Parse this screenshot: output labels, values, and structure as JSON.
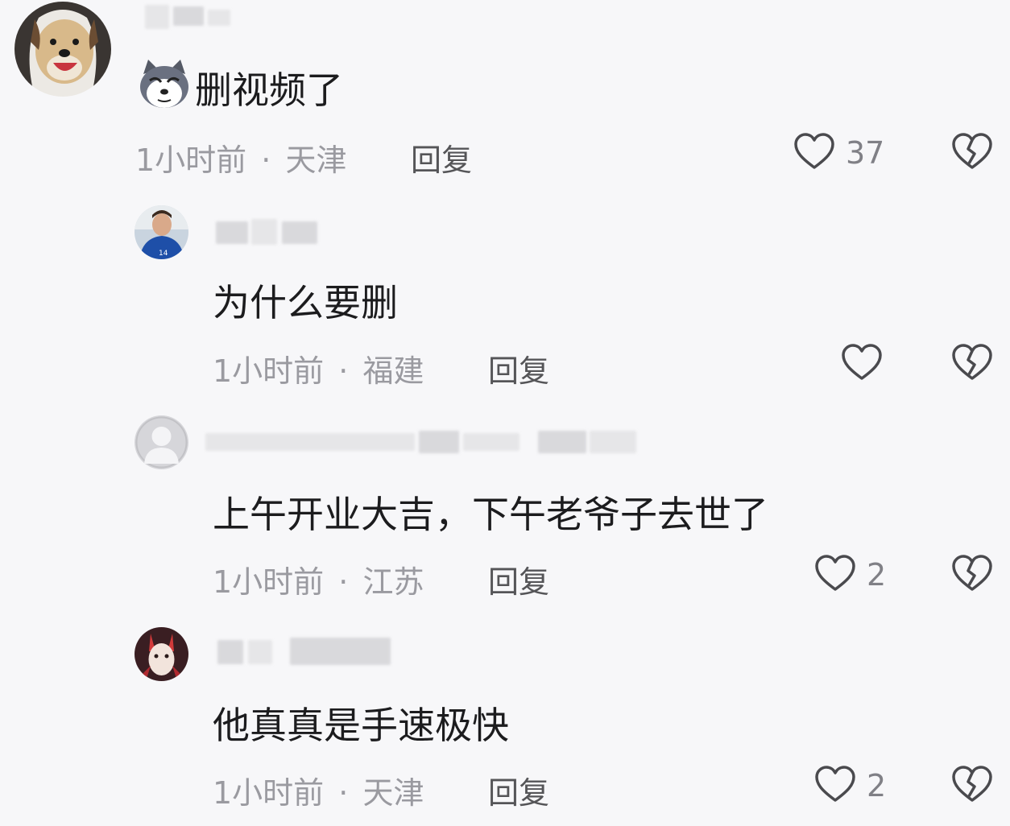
{
  "comments": [
    {
      "text": "删视频了",
      "time": "1小时前",
      "separator": "·",
      "location": "天津",
      "reply_label": "回复",
      "likes": "37",
      "emoji_icon": "husky-face-icon"
    },
    {
      "text": "为什么要删",
      "time": "1小时前",
      "separator": "·",
      "location": "福建",
      "reply_label": "回复",
      "likes": ""
    },
    {
      "text": "上午开业大吉，下午老爷子去世了",
      "time": "1小时前",
      "separator": "·",
      "location": "江苏",
      "reply_label": "回复",
      "likes": "2"
    },
    {
      "text": "他真真是手速极快",
      "time": "1小时前",
      "separator": "·",
      "location": "天津",
      "reply_label": "回复",
      "likes": "2"
    }
  ],
  "icons": {
    "like": "heart-outline-icon",
    "dislike": "broken-heart-icon"
  },
  "colors": {
    "background": "#f7f7f9",
    "comment_text": "#1c1c1e",
    "meta_text": "#9a9aa0",
    "reply_text": "#555558",
    "icon_stroke": "#4a4a4e"
  }
}
